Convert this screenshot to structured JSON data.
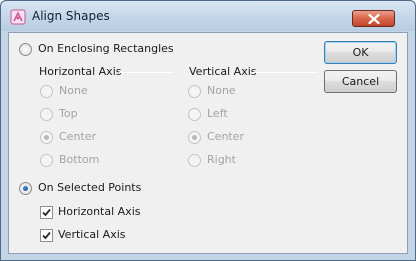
{
  "window": {
    "title": "Align Shapes",
    "close_label": "×"
  },
  "enclosing": {
    "label": "On Enclosing Rectangles",
    "selected": false,
    "horizontal_axis": {
      "title": "Horizontal Axis",
      "options": [
        {
          "label": "None",
          "selected": false
        },
        {
          "label": "Top",
          "selected": false
        },
        {
          "label": "Center",
          "selected": true
        },
        {
          "label": "Bottom",
          "selected": false
        }
      ]
    },
    "vertical_axis": {
      "title": "Vertical Axis",
      "options": [
        {
          "label": "None",
          "selected": false
        },
        {
          "label": "Left",
          "selected": false
        },
        {
          "label": "Center",
          "selected": true
        },
        {
          "label": "Right",
          "selected": false
        }
      ]
    }
  },
  "selected_points": {
    "label": "On Selected Points",
    "selected": true,
    "horizontal_axis": {
      "label": "Horizontal Axis",
      "checked": true
    },
    "vertical_axis": {
      "label": "Vertical Axis",
      "checked": true
    }
  },
  "buttons": {
    "ok": "OK",
    "cancel": "Cancel"
  },
  "colors": {
    "radio_selected": "#1c5da6",
    "disabled_text": "#a3a3a3",
    "frame": "#c2d4e6",
    "close_button": "#d86a4f"
  }
}
